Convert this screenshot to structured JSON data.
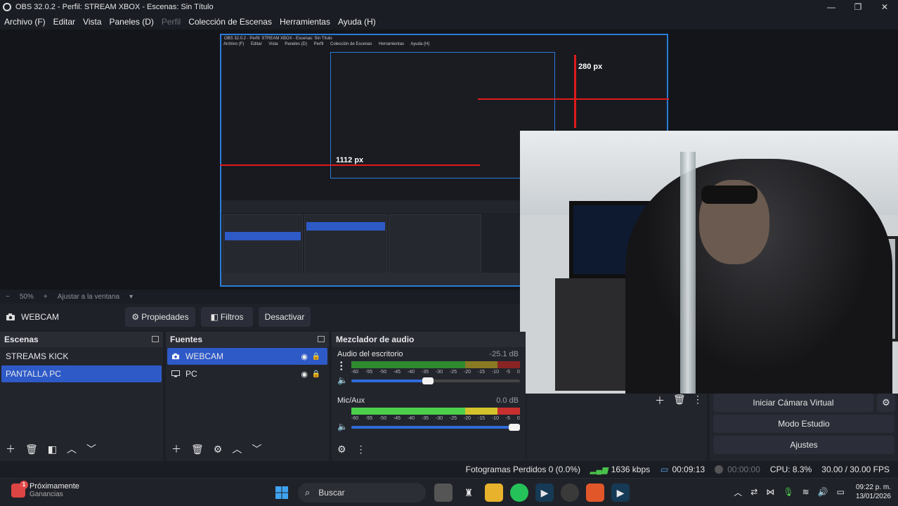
{
  "window": {
    "title": "OBS 32.0.2 - Perfil: STREAM XBOX - Escenas: Sin Título",
    "minimize": "—",
    "maximize": "❐",
    "close": "✕"
  },
  "menu": [
    "Archivo (F)",
    "Editar",
    "Vista",
    "Paneles (D)",
    "Perfil",
    "Colección de Escenas",
    "Herramientas",
    "Ayuda (H)"
  ],
  "preview": {
    "guide_top": "280 px",
    "guide_left": "1112 px",
    "nested_title": "OBS 32.0.2 - Perfil: STREAM XBOX - Escenas: Sin Título",
    "nested_menu": [
      "Archivo (F)",
      "Editar",
      "Vista",
      "Paneles (D)",
      "Perfil",
      "Colección de Escenas",
      "Herramientas",
      "Ayuda (H)"
    ]
  },
  "zoom": {
    "minus": "−",
    "value": "50%",
    "plus": "+",
    "fit": "Ajustar a la ventana",
    "caret": "▾"
  },
  "source_toolbar": {
    "source": "WEBCAM",
    "properties": "Propiedades",
    "filters": "Filtros",
    "deactivate": "Desactivar"
  },
  "scenes": {
    "header": "Escenas",
    "items": [
      "STREAMS KICK",
      "PANTALLA PC"
    ],
    "selected": 1
  },
  "sources": {
    "header": "Fuentes",
    "items": [
      {
        "icon": "camera-icon",
        "label": "WEBCAM"
      },
      {
        "icon": "monitor-icon",
        "label": "PC"
      }
    ],
    "selected": 0
  },
  "mixer": {
    "header": "Mezclador de audio",
    "tracks": [
      {
        "name": "Audio del escritorio",
        "db": "-25.1 dB",
        "volume": 0.42
      },
      {
        "name": "Mic/Aux",
        "db": "0.0 dB",
        "volume": 1.0
      }
    ],
    "ticks": [
      "-60",
      "-55",
      "-50",
      "-45",
      "-40",
      "-35",
      "-30",
      "-25",
      "-20",
      "-15",
      "-10",
      "-5",
      "0"
    ]
  },
  "controls": {
    "virtual_camera": "Iniciar Cámara Virtual",
    "studio_mode": "Modo Estudio",
    "settings": "Ajustes"
  },
  "status": {
    "dropped": "Fotogramas Perdidos 0 (0.0%)",
    "bitrate": "1636 kbps",
    "live_time": "00:09:13",
    "rec_time": "00:00:00",
    "cpu": "CPU: 8.3%",
    "fps": "30.00 / 30.00 FPS"
  },
  "taskbar": {
    "weather_title": "Próximamente",
    "weather_sub": "Ganancias",
    "weather_badge": "1",
    "search": "Buscar",
    "time": "09:22 p. m.",
    "date": "13/01/2026"
  },
  "colors": {
    "accent": "#2e5ac8",
    "guide": "#e01a1a",
    "meter_green": "#4cd04c",
    "meter_yellow": "#d4c22c",
    "meter_red": "#c83030"
  }
}
